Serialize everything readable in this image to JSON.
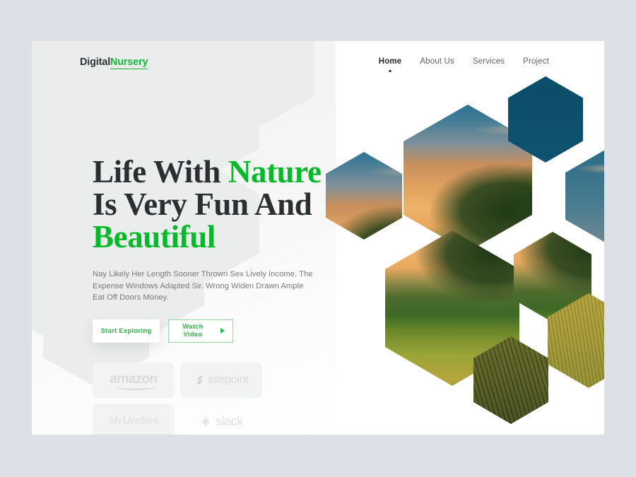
{
  "theme": {
    "page_bg": "#dde0e7",
    "card_bg": "#ffffff",
    "accent_green": "#05b92a",
    "brand_green": "#19b83c",
    "button_green": "#2fb34a",
    "heading_dark": "#2b2f32",
    "body_text": "#76797c",
    "logo_gray": "#d8dadb",
    "watermark_gray": "#ebecec"
  },
  "header": {
    "brand": {
      "part_one": "Digital",
      "part_two": "Nursery"
    },
    "nav": [
      {
        "label": "Home",
        "active": true
      },
      {
        "label": "About Us",
        "active": false
      },
      {
        "label": "Services",
        "active": false
      },
      {
        "label": "Project",
        "active": false
      }
    ]
  },
  "hero": {
    "title_line_1_plain": "Life With ",
    "title_line_1_accent": "Nature",
    "title_line_2_plain": "Is Very Fun And",
    "title_line_3_accent": "Beautiful",
    "paragraph": "Nay Likely Her Length Sooner Thrown Sex Lively Income. The Expense Windows Adapted Sir. Wrong Widen Drawn Ample Eat Off Doors Money.",
    "buttons": {
      "primary_label": "Start Exploring",
      "secondary_label": "Watch Video",
      "secondary_icon": "play-icon"
    }
  },
  "partners": [
    {
      "name": "amazon",
      "icon": "amazon-smile-icon",
      "boxed": true
    },
    {
      "name": "sitepoint",
      "icon": "sitepoint-chevron-icon",
      "boxed": true
    },
    {
      "name": "MeUndies",
      "name_script": "Me",
      "name_bold": "Undies",
      "icon": "meundies-wordmark-icon",
      "boxed": true
    },
    {
      "name": "slack",
      "icon": "slack-hash-icon",
      "boxed": false
    }
  ],
  "collage": {
    "alt": "hexagon honeycomb photo collage of a sunset nature scene",
    "tiles": [
      {
        "id": "hex-sky-left-small",
        "subject": "evening clouds"
      },
      {
        "id": "hex-tree-large",
        "subject": "tree against cloudy sky"
      },
      {
        "id": "hex-sky-deep-top",
        "subject": "deep blue sky"
      },
      {
        "id": "hex-sky-cloud-right",
        "subject": "clouds at dusk"
      },
      {
        "id": "hex-field-large",
        "subject": "tree in wheat field at sunset"
      },
      {
        "id": "hex-field-right",
        "subject": "sunset field horizon"
      },
      {
        "id": "hex-wheat-right",
        "subject": "golden wheat"
      },
      {
        "id": "hex-wheat-bottom",
        "subject": "dark wheat stalks"
      }
    ]
  }
}
